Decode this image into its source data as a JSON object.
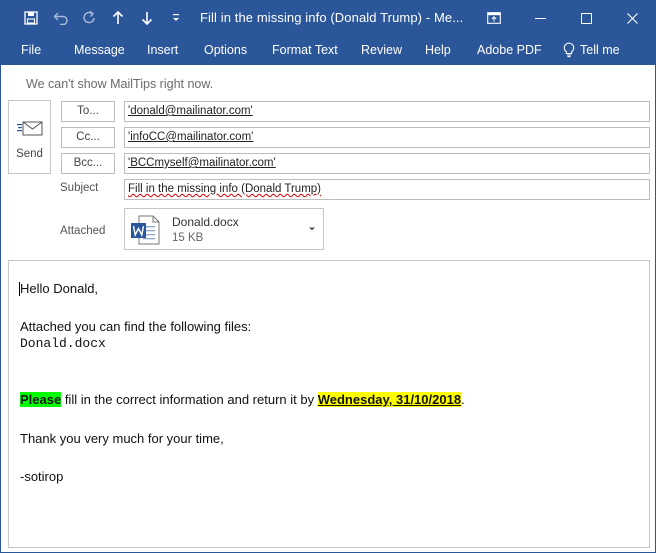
{
  "titlebar": {
    "title": "Fill in the missing info (Donald Trump)  -  Me...",
    "icons": [
      "save-icon",
      "undo-icon",
      "redo-icon",
      "arrow-up-icon",
      "arrow-down-icon",
      "customize-qat-icon",
      "ribbon-display-icon",
      "minimize-icon",
      "maximize-icon",
      "close-icon"
    ]
  },
  "ribbon": {
    "tabs": [
      "File",
      "Message",
      "Insert",
      "Options",
      "Format Text",
      "Review",
      "Help",
      "Adobe PDF"
    ],
    "tell_me": "Tell me"
  },
  "mailtips": "We can't show MailTips right now.",
  "send": {
    "label": "Send"
  },
  "to": {
    "button": "To...",
    "value": "'donald@mailinator.com'"
  },
  "cc": {
    "button": "Cc...",
    "value": "'infoCC@mailinator.com'"
  },
  "bcc": {
    "button": "Bcc...",
    "value": "'BCCmyself@mailinator.com'"
  },
  "subject": {
    "label": "Subject",
    "value": "Fill in the missing info (Donald Trump)"
  },
  "attached": {
    "label": "Attached",
    "file_name": "Donald.docx",
    "file_size": "15 KB"
  },
  "body": {
    "greeting": "Hello Donald,",
    "line1": "Attached you can find the following files:",
    "file": "Donald.docx",
    "please": "Please",
    "instruction": " fill in the correct information and return it by ",
    "deadline": "Wednesday, 31/10/2018",
    "period": ".",
    "thanks": "Thank you very much for your time,",
    "signature": "-sotirop"
  },
  "colors": {
    "accent": "#2b579a",
    "highlight_green": "#00ff00",
    "highlight_yellow": "#ffff00"
  }
}
